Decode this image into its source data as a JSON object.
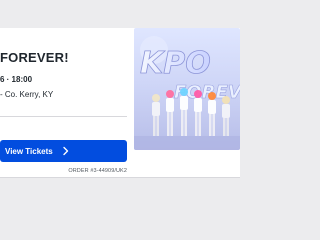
{
  "event": {
    "title": "FOREVER!",
    "datetime": "6 · 18:00",
    "venue": "- Co. Kerry, KY",
    "button_label": "View Tickets",
    "order": "ORDER #3-44909/UK2"
  },
  "poster": {
    "line1": "KPO",
    "line2": "FOREV"
  },
  "colors": {
    "button": "#024ddf",
    "text": "#1f262d",
    "background": "#ececee"
  }
}
